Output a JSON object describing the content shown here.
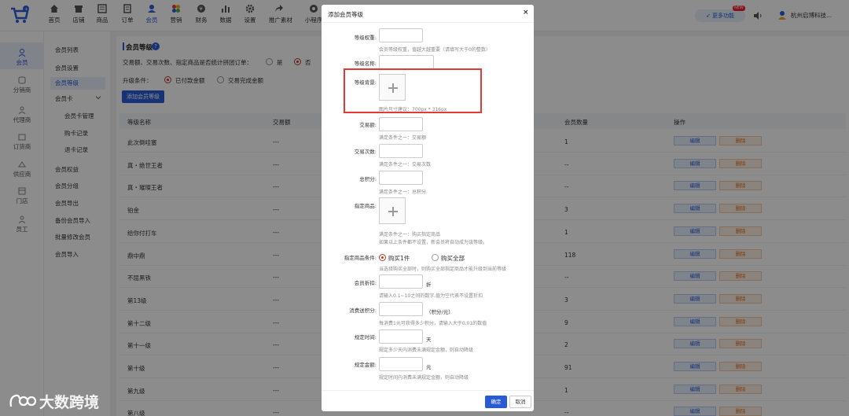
{
  "topnav": {
    "items": [
      {
        "label": "首页",
        "icon": "home-icon"
      },
      {
        "label": "店铺",
        "icon": "store-icon"
      },
      {
        "label": "商品",
        "icon": "goods-icon"
      },
      {
        "label": "订单",
        "icon": "order-icon"
      },
      {
        "label": "会员",
        "icon": "member-icon",
        "active": true
      },
      {
        "label": "营销",
        "icon": "marketing-icon"
      },
      {
        "label": "财务",
        "icon": "finance-icon"
      },
      {
        "label": "数据",
        "icon": "data-icon"
      },
      {
        "label": "设置",
        "icon": "settings-icon"
      },
      {
        "label": "推广素材",
        "icon": "share-icon"
      },
      {
        "label": "小程序",
        "icon": "miniprogram-icon"
      }
    ],
    "feature_label": "更多功能",
    "new_badge": "NEW",
    "user_name": "杭州启博科技..."
  },
  "sidebar1": {
    "items": [
      {
        "label": "会员",
        "icon": "member-icon",
        "active": true
      },
      {
        "label": "分销商",
        "icon": "distributor-icon"
      },
      {
        "label": "代理商",
        "icon": "agent-icon"
      },
      {
        "label": "订货商",
        "icon": "orderer-icon"
      },
      {
        "label": "供应商",
        "icon": "supplier-icon"
      },
      {
        "label": "门店",
        "icon": "shop-icon"
      },
      {
        "label": "员工",
        "icon": "staff-icon"
      }
    ]
  },
  "sidebar2": {
    "items": [
      {
        "label": "会员列表"
      },
      {
        "label": "会员设置"
      },
      {
        "label": "会员等级",
        "active": true
      },
      {
        "label": "会员卡"
      },
      {
        "label": "会员卡管理",
        "sub": true
      },
      {
        "label": "购卡记录",
        "sub": true
      },
      {
        "label": "退卡记录",
        "sub": true
      },
      {
        "label": "会员权益"
      },
      {
        "label": "会员分组"
      },
      {
        "label": "会员导出"
      },
      {
        "label": "备份会员导入"
      },
      {
        "label": "批量修改会员"
      },
      {
        "label": "会员导入"
      }
    ]
  },
  "main": {
    "title": "会员等级",
    "help": "?",
    "setting_text": "交易额、交易次数、指定商品是否统计拼团订单：",
    "opt_yes": "是",
    "opt_no": "否",
    "upgrade_label": "升级条件：",
    "upgrade_paid": "已付款金额",
    "upgrade_done": "交易完成金额",
    "add_button": "添加会员等级",
    "columns": [
      "等级名称",
      "交易额",
      "会员数量",
      "操作"
    ],
    "rows": [
      {
        "name": "此次倒哇塞",
        "amount": "---",
        "count": "1"
      },
      {
        "name": "真・绝世王者",
        "amount": "---",
        "count": "--"
      },
      {
        "name": "真・璀璨王者",
        "amount": "---",
        "count": "--"
      },
      {
        "name": "铂金",
        "amount": "---",
        "count": "3"
      },
      {
        "name": "给你付打车",
        "amount": "---",
        "count": "1"
      },
      {
        "name": "鼎中鼎",
        "amount": "---",
        "count": "118"
      },
      {
        "name": "不屈黑铁",
        "amount": "---",
        "count": "--"
      },
      {
        "name": "第13级",
        "amount": "---",
        "count": "3"
      },
      {
        "name": "第十二级",
        "amount": "---",
        "count": "9"
      },
      {
        "name": "第十一级",
        "amount": "---",
        "count": "2"
      },
      {
        "name": "第十级",
        "amount": "---",
        "count": "91"
      },
      {
        "name": "第九级",
        "amount": "---",
        "count": "1"
      },
      {
        "name": "第八级",
        "amount": "---",
        "count": "--"
      }
    ],
    "edit_label": "编辑",
    "delete_label": "删除"
  },
  "modal": {
    "title": "添加会员等级",
    "close": "×",
    "weight_label": "等级权重:",
    "weight_hint": "会员等级权重，值越大越重要（请填写大于0的整数）",
    "name_label": "等级名称:",
    "bg_label": "等级背景:",
    "bg_hint": "图片尺寸建议：700px * 316px",
    "amount_label": "交易额:",
    "amount_hint": "满足条件之一：交易额",
    "times_label": "交易次数:",
    "times_hint": "满足条件之一：交易次数",
    "points_label": "总积分:",
    "points_hint": "满足条件之一：总积分",
    "goods_label": "指定商品:",
    "goods_hint1": "满足条件之一：购买指定商品",
    "goods_hint2": "如果以上条件都不设置，新会员将自动成为该等级。",
    "goods_cond_label": "指定商品条件:",
    "buy_one": "购买1件",
    "buy_all": "购买全部",
    "goods_cond_hint": "当选择购买全部时，则购买全部指定商品才能升级到当前等级",
    "discount_label": "会员折扣:",
    "discount_unit": "折",
    "discount_hint": "请输入0.1~10之间的数字,值为空代表不设置折扣",
    "consume_label": "消费送积分:",
    "consume_unit": "（积分/元）",
    "consume_hint": "每消费1元可获得多少积分，请输入大于0.01的数值",
    "period_label": "规定时间:",
    "period_unit": "天",
    "period_hint": "规定多少天内消费未满规定金额，则自动降级",
    "limit_label": "规定金额:",
    "limit_unit": "元",
    "limit_hint": "规定时间内消费未满规定金额，则自动降级",
    "ok": "确定",
    "cancel": "取消"
  },
  "watermark": "大数跨境",
  "colors": {
    "accent": "#2a5bd7",
    "highlight": "#e53935"
  }
}
